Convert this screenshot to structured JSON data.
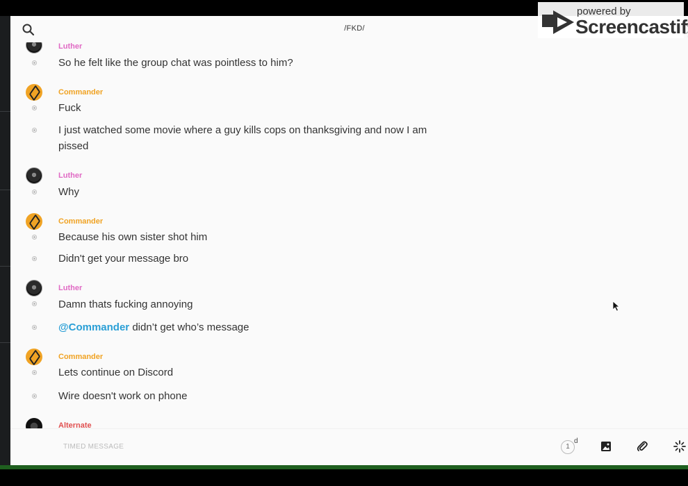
{
  "header": {
    "title": "/FKD/",
    "search_icon": "search-icon",
    "call_icon": "phone-icon",
    "info_icon": "info-icon"
  },
  "watermark": {
    "line1": "powered by",
    "line2": "Screencastify"
  },
  "colors": {
    "luther": "#e06ac4",
    "commander": "#f0a324",
    "alternate": "#e05050",
    "mention": "#2a9fd6"
  },
  "messages": [
    {
      "sender": "Luther",
      "texts": [
        "So he felt like the group chat was pointless to him?"
      ]
    },
    {
      "sender": "Commander",
      "texts": [
        "Fuck",
        "I just watched some movie where a guy kills cops on thanksgiving and now I am pissed"
      ]
    },
    {
      "sender": "Luther",
      "texts": [
        "Why"
      ]
    },
    {
      "sender": "Commander",
      "texts": [
        "Because his own sister shot him",
        "Didn't get your message bro"
      ]
    },
    {
      "sender": "Luther",
      "texts": [
        "Damn thats fucking annoying"
      ],
      "mention_message": {
        "mention": "@Commander",
        "rest": " didn’t get who’s message"
      }
    },
    {
      "sender": "Commander",
      "texts": [
        "Lets continue on Discord",
        "Wire doesn't work on phone"
      ]
    },
    {
      "sender": "Alternate",
      "texts": []
    }
  ],
  "composer": {
    "placeholder": "TIMED MESSAGE",
    "timer_value": "1",
    "timer_unit": "d",
    "image_icon": "image-icon",
    "attach_icon": "paperclip-icon",
    "ping_icon": "ping-icon"
  }
}
